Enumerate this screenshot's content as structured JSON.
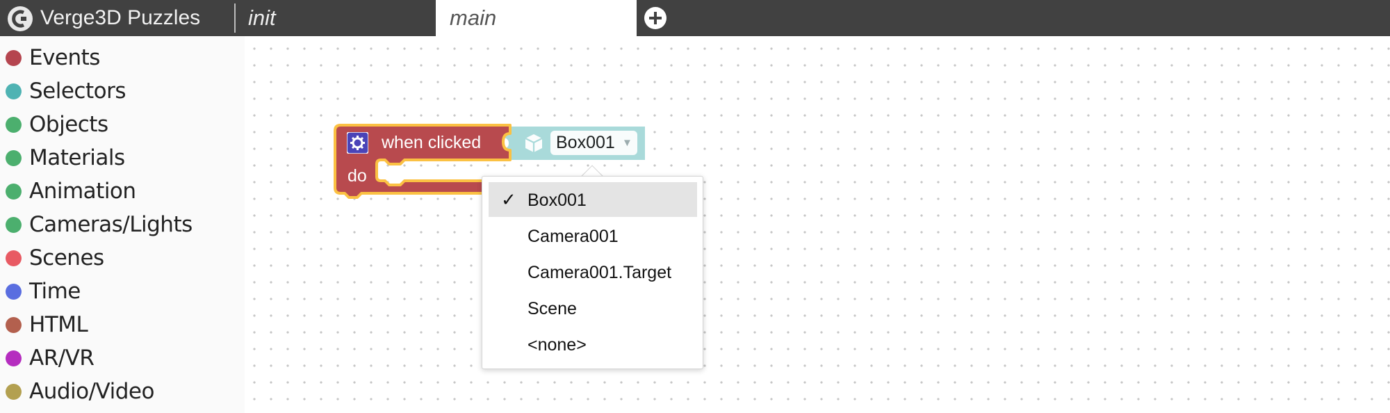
{
  "app": {
    "title": "Verge3D Puzzles"
  },
  "tabs": [
    {
      "label": "init",
      "active": false
    },
    {
      "label": "main",
      "active": true
    }
  ],
  "sidebar": {
    "categories": [
      {
        "label": "Events",
        "color": "#b5454f"
      },
      {
        "label": "Selectors",
        "color": "#4fb3b3"
      },
      {
        "label": "Objects",
        "color": "#4caf6e"
      },
      {
        "label": "Materials",
        "color": "#4caf6e"
      },
      {
        "label": "Animation",
        "color": "#4caf6e"
      },
      {
        "label": "Cameras/Lights",
        "color": "#4caf6e"
      },
      {
        "label": "Scenes",
        "color": "#e85a63"
      },
      {
        "label": "Time",
        "color": "#5a6ee0"
      },
      {
        "label": "HTML",
        "color": "#b3604e"
      },
      {
        "label": "AR/VR",
        "color": "#b52dbf"
      },
      {
        "label": "Audio/Video",
        "color": "#b3a050"
      }
    ]
  },
  "block": {
    "label": "when clicked",
    "do_label": "do",
    "object_value": "Box001",
    "colors": {
      "event": "#b84a4e",
      "highlight": "#fbc143",
      "selector": "#a9dada",
      "gear": "#4a44b8"
    }
  },
  "dropdown": {
    "items": [
      {
        "label": "Box001",
        "selected": true,
        "check": "✓"
      },
      {
        "label": "Camera001",
        "selected": false,
        "check": ""
      },
      {
        "label": "Camera001.Target",
        "selected": false,
        "check": ""
      },
      {
        "label": "Scene",
        "selected": false,
        "check": ""
      },
      {
        "label": "<none>",
        "selected": false,
        "check": ""
      }
    ]
  }
}
